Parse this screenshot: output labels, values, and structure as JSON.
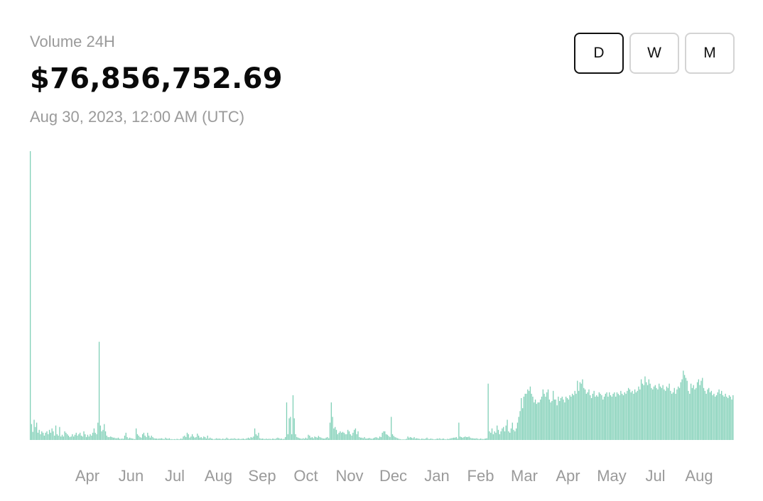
{
  "header": {
    "label": "Volume 24H",
    "value": "$76,856,752.69",
    "timestamp": "Aug 30, 2023, 12:00 AM (UTC)"
  },
  "range_buttons": [
    {
      "label": "D",
      "active": true
    },
    {
      "label": "W",
      "active": false
    },
    {
      "label": "M",
      "active": false
    }
  ],
  "colors": {
    "bar": "#7fcfb6",
    "bar_stroke": "#5ebd9f",
    "muted_text": "#9a9a9a"
  },
  "chart_data": {
    "type": "bar",
    "title": "",
    "xlabel": "",
    "ylabel": "",
    "x_tick_labels": [
      "Apr",
      "Jun",
      "Jul",
      "Aug",
      "Sep",
      "Oct",
      "Nov",
      "Dec",
      "Jan",
      "Feb",
      "Mar",
      "Apr",
      "May",
      "Jul",
      "Aug"
    ],
    "ylim": [
      0,
      1000
    ],
    "grid": false,
    "series": [
      {
        "values": [
          1000,
          55,
          28,
          70,
          45,
          60,
          25,
          35,
          20,
          30,
          25,
          15,
          25,
          30,
          20,
          35,
          25,
          40,
          30,
          15,
          50,
          20,
          15,
          45,
          12,
          18,
          12,
          30,
          25,
          20,
          15,
          10,
          12,
          20,
          12,
          18,
          25,
          15,
          20,
          25,
          15,
          12,
          30,
          20,
          10,
          18,
          12,
          20,
          15,
          25,
          40,
          25,
          20,
          60,
          340,
          50,
          30,
          35,
          55,
          30,
          15,
          10,
          10,
          12,
          10,
          8,
          8,
          6,
          6,
          8,
          4,
          4,
          5,
          4,
          15,
          25,
          10,
          5,
          8,
          6,
          5,
          4,
          3,
          40,
          20,
          15,
          10,
          8,
          20,
          25,
          15,
          10,
          25,
          15,
          8,
          15,
          10,
          6,
          5,
          5,
          4,
          5,
          5,
          6,
          4,
          3,
          8,
          5,
          4,
          6,
          3,
          3,
          2,
          3,
          2,
          4,
          3,
          2,
          5,
          4,
          12,
          15,
          10,
          25,
          20,
          8,
          12,
          20,
          12,
          8,
          10,
          22,
          15,
          8,
          10,
          6,
          12,
          10,
          5,
          15,
          5,
          8,
          5,
          4,
          2,
          4,
          6,
          4,
          5,
          4,
          3,
          5,
          3,
          4,
          8,
          5,
          3,
          4,
          5,
          4,
          6,
          4,
          3,
          5,
          4,
          3,
          4,
          5,
          3,
          4,
          6,
          8,
          5,
          10,
          8,
          12,
          40,
          20,
          15,
          25,
          6,
          4,
          5,
          4,
          3,
          5,
          3,
          4,
          4,
          3,
          5,
          4,
          3,
          6,
          8,
          6,
          4,
          5,
          3,
          4,
          10,
          130,
          20,
          75,
          80,
          20,
          155,
          75,
          20,
          10,
          8,
          6,
          5,
          4,
          6,
          4,
          8,
          5,
          18,
          15,
          8,
          10,
          6,
          12,
          10,
          8,
          14,
          10,
          8,
          6,
          5,
          5,
          8,
          10,
          6,
          60,
          130,
          80,
          40,
          45,
          35,
          20,
          25,
          30,
          25,
          28,
          25,
          20,
          20,
          35,
          30,
          20,
          15,
          25,
          35,
          40,
          20,
          30,
          10,
          8,
          8,
          6,
          10,
          5,
          5,
          6,
          7,
          5,
          4,
          6,
          8,
          10,
          8,
          6,
          12,
          10,
          25,
          30,
          30,
          20,
          18,
          14,
          10,
          80,
          20,
          14,
          10,
          8,
          6,
          4,
          3,
          2,
          2,
          2,
          2,
          4,
          12,
          8,
          10,
          8,
          6,
          10,
          5,
          6,
          5,
          4,
          3,
          5,
          4,
          3,
          5,
          8,
          4,
          3,
          5,
          4,
          3,
          2,
          3,
          5,
          4,
          6,
          3,
          4,
          5,
          3,
          2,
          4,
          3,
          5,
          6,
          7,
          8,
          8,
          10,
          5,
          60,
          12,
          10,
          8,
          10,
          12,
          10,
          10,
          12,
          8,
          6,
          6,
          5,
          5,
          6,
          4,
          3,
          5,
          4,
          3,
          4,
          5,
          6,
          195,
          30,
          25,
          40,
          20,
          30,
          25,
          50,
          35,
          20,
          30,
          40,
          45,
          30,
          50,
          70,
          30,
          25,
          40,
          60,
          35,
          30,
          40,
          60,
          80,
          100,
          145,
          110,
          150,
          160,
          160,
          175,
          170,
          185,
          160,
          150,
          130,
          140,
          125,
          130,
          130,
          140,
          150,
          175,
          160,
          150,
          165,
          175,
          140,
          130,
          135,
          170,
          140,
          140,
          120,
          150,
          135,
          145,
          150,
          140,
          130,
          150,
          145,
          140,
          155,
          150,
          160,
          155,
          170,
          160,
          205,
          170,
          200,
          195,
          210,
          180,
          175,
          160,
          165,
          175,
          155,
          145,
          160,
          170,
          150,
          155,
          150,
          165,
          160,
          155,
          140,
          150,
          160,
          165,
          150,
          165,
          155,
          150,
          160,
          165,
          150,
          165,
          160,
          155,
          170,
          160,
          155,
          165,
          160,
          170,
          180,
          175,
          165,
          170,
          160,
          175,
          165,
          170,
          185,
          175,
          210,
          195,
          190,
          220,
          200,
          190,
          210,
          195,
          180,
          175,
          185,
          190,
          180,
          175,
          195,
          185,
          180,
          190,
          175,
          170,
          185,
          180,
          195,
          170,
          160,
          165,
          180,
          160,
          175,
          185,
          180,
          200,
          210,
          240,
          225,
          215,
          205,
          170,
          160,
          195,
          180,
          190,
          175,
          180,
          200,
          210,
          190,
          205,
          215,
          180,
          170,
          160,
          175,
          180,
          165,
          170,
          155,
          160,
          150,
          155,
          165,
          175,
          160,
          170,
          155,
          150,
          160,
          150,
          145,
          155,
          150,
          140,
          155
        ]
      }
    ]
  }
}
